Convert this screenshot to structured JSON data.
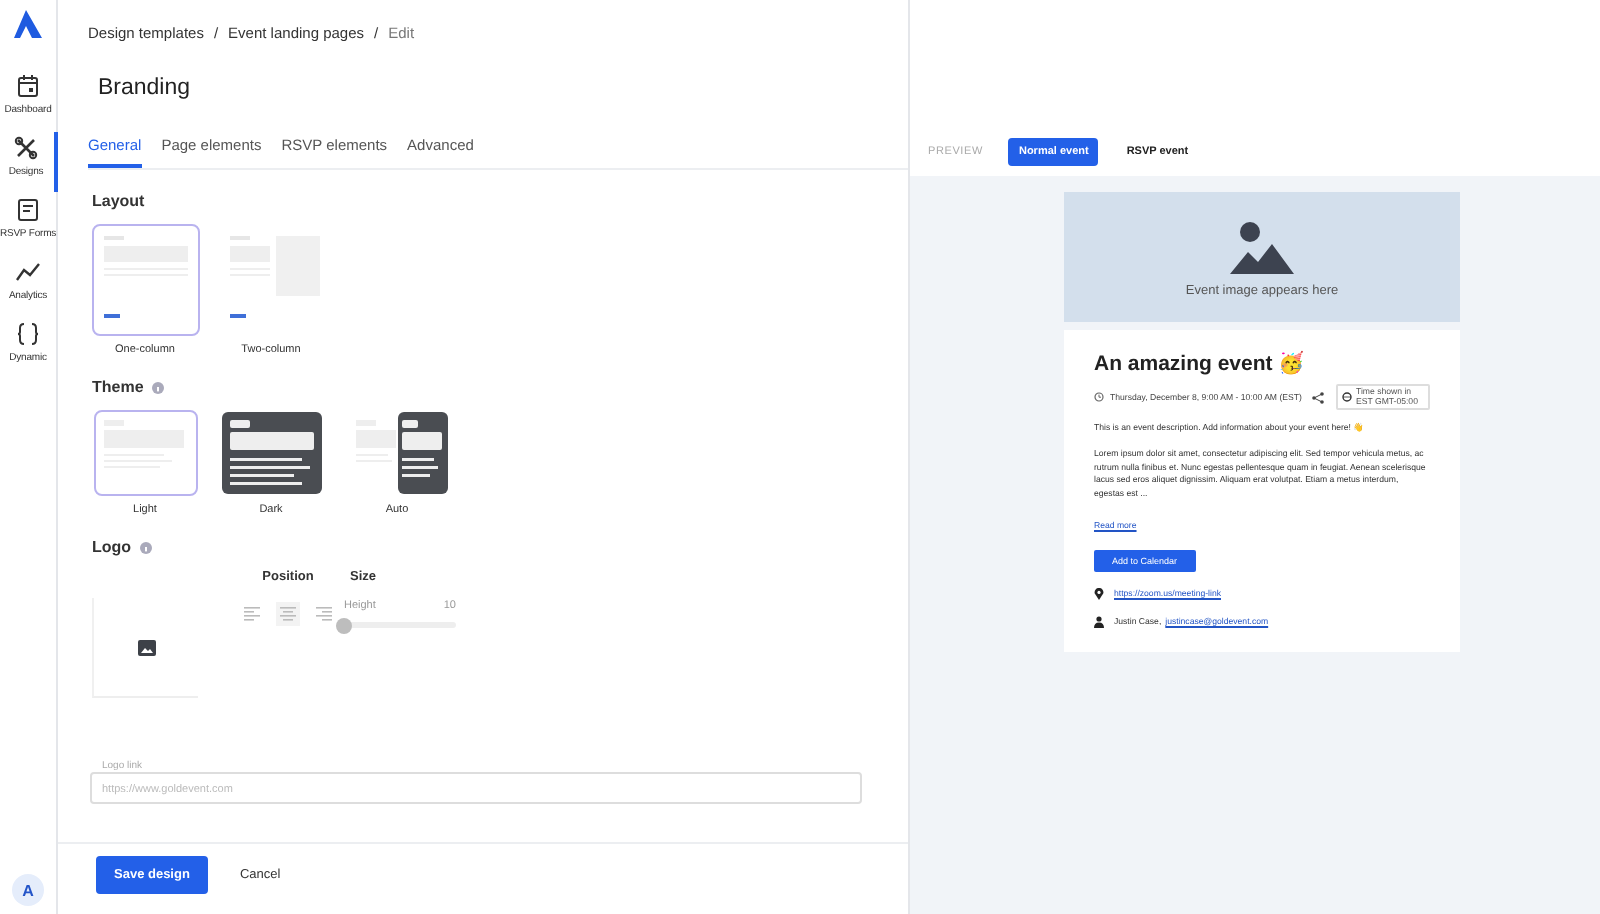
{
  "sidebar": {
    "items": [
      {
        "label": "Dashboard",
        "kind": "calendar",
        "selected": false
      },
      {
        "label": "Designs",
        "kind": "tools",
        "selected": true
      },
      {
        "label": "RSVP Forms",
        "kind": "form",
        "selected": false
      },
      {
        "label": "Analytics",
        "kind": "chart",
        "selected": false
      },
      {
        "label": "Dynamic",
        "kind": "braces",
        "selected": false
      }
    ],
    "avatar": "A"
  },
  "breadcrumb": {
    "separator": "/",
    "items": [
      "Design templates",
      "Event landing pages",
      "Edit"
    ]
  },
  "title": "Branding",
  "tabs": [
    {
      "label": "General",
      "selected": true
    },
    {
      "label": "Page elements",
      "selected": false
    },
    {
      "label": "RSVP elements",
      "selected": false
    },
    {
      "label": "Advanced",
      "selected": false
    }
  ],
  "layout": {
    "heading": "Layout",
    "options": [
      {
        "label": "One-column",
        "kind": "one",
        "selected": true
      },
      {
        "label": "Two-column",
        "kind": "two",
        "selected": false
      }
    ]
  },
  "theme": {
    "heading": "Theme",
    "options": [
      {
        "label": "Light",
        "kind": "light",
        "selected": true
      },
      {
        "label": "Dark",
        "kind": "dark",
        "selected": false
      },
      {
        "label": "Auto",
        "kind": "auto",
        "selected": false
      }
    ]
  },
  "logo": {
    "heading": "Logo",
    "position_heading": "Position",
    "size_heading": "Size",
    "positions": [
      {
        "kind": "left",
        "selected": false
      },
      {
        "kind": "center",
        "selected": true
      },
      {
        "kind": "right",
        "selected": false
      }
    ],
    "height_label": "Height",
    "height_value": "10",
    "level": 0,
    "link_label": "Logo link",
    "link_placeholder": "https://www.goldevent.com"
  },
  "footer": {
    "save": "Save design",
    "cancel": "Cancel"
  },
  "preview": {
    "label": "PREVIEW",
    "modes": [
      {
        "label": "Normal event",
        "selected": true
      },
      {
        "label": "RSVP event",
        "selected": false
      }
    ],
    "image_caption": "Event image appears here",
    "event": {
      "title": "An amazing event 🥳",
      "date": "Thursday, December 8, 9:00 AM - 10:00 AM (EST)",
      "timezone": "Time shown in EST GMT-05:00",
      "description": "This is an event description. Add information about your event here! 👋",
      "body": "Lorem ipsum dolor sit amet, consectetur adipiscing elit. Sed tempor vehicula metus, ac rutrum nulla finibus et. Nunc egestas pellentesque quam in feugiat. Aenean scelerisque lacus sed eros aliquet dignissim. Aliquam erat volutpat. Etiam a metus interdum, egestas est ...",
      "read_more": "Read more",
      "calendar_button": "Add to Calendar",
      "location_link": "https://zoom.us/meeting-link",
      "host": "Justin Case,",
      "host_email": "justincase@goldevent.com"
    }
  }
}
